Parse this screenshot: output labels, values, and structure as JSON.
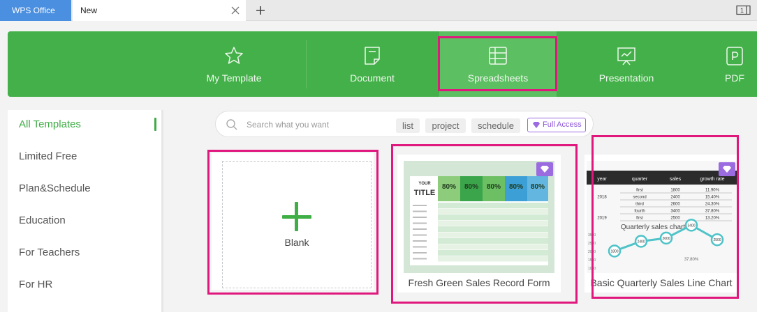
{
  "tabs": {
    "app": "WPS Office",
    "document": "New"
  },
  "categories": [
    {
      "label": "My Template",
      "icon": "star-icon"
    },
    {
      "label": "Document",
      "icon": "document-icon"
    },
    {
      "label": "Spreadsheets",
      "icon": "spreadsheet-icon"
    },
    {
      "label": "Presentation",
      "icon": "presentation-icon"
    },
    {
      "label": "PDF",
      "icon": "pdf-icon"
    }
  ],
  "sidebar": {
    "items": [
      {
        "label": "All Templates"
      },
      {
        "label": "Limited Free"
      },
      {
        "label": "Plan&Schedule"
      },
      {
        "label": "Education"
      },
      {
        "label": "For Teachers"
      },
      {
        "label": "For HR"
      }
    ]
  },
  "search": {
    "placeholder": "Search what you want",
    "tags": [
      "list",
      "project",
      "schedule"
    ],
    "full_access": "Full Access"
  },
  "cards": [
    {
      "title": "Blank"
    },
    {
      "title": "Fresh Green Sales Record Form",
      "preview": {
        "heading_small": "YOUR",
        "heading": "TITLE",
        "percent": [
          "80%",
          "80%",
          "80%",
          "80%",
          "80%"
        ],
        "colors": [
          "#8dcc7a",
          "#3aa54a",
          "#6cbf62",
          "#3c9fd6",
          "#63b6e0"
        ]
      }
    },
    {
      "title": "Basic Quarterly Sales Line Chart",
      "preview": {
        "columns": [
          "year",
          "quarter",
          "sales",
          "growth rate"
        ],
        "rows": [
          [
            "",
            "first",
            "1800",
            "11.90%"
          ],
          [
            "2018",
            "second",
            "2400",
            "15.40%"
          ],
          [
            "",
            "third",
            "2600",
            "24.30%"
          ],
          [
            "",
            "fourth",
            "3400",
            "37.80%"
          ],
          [
            "2019",
            "first",
            "2500",
            "13.20%"
          ]
        ],
        "chart_title": "Quarterly sales chart",
        "points": [
          "1800",
          "2400",
          "2600",
          "3400",
          "2500"
        ],
        "axis": [
          "3500",
          "2500",
          "2000",
          "1500",
          "1000"
        ],
        "footnote": "37.80%"
      }
    }
  ],
  "colors": {
    "ribbon": "#44b049",
    "accent": "#3fab45",
    "highlight": "#e0177d",
    "premium": "#9b6be0"
  }
}
